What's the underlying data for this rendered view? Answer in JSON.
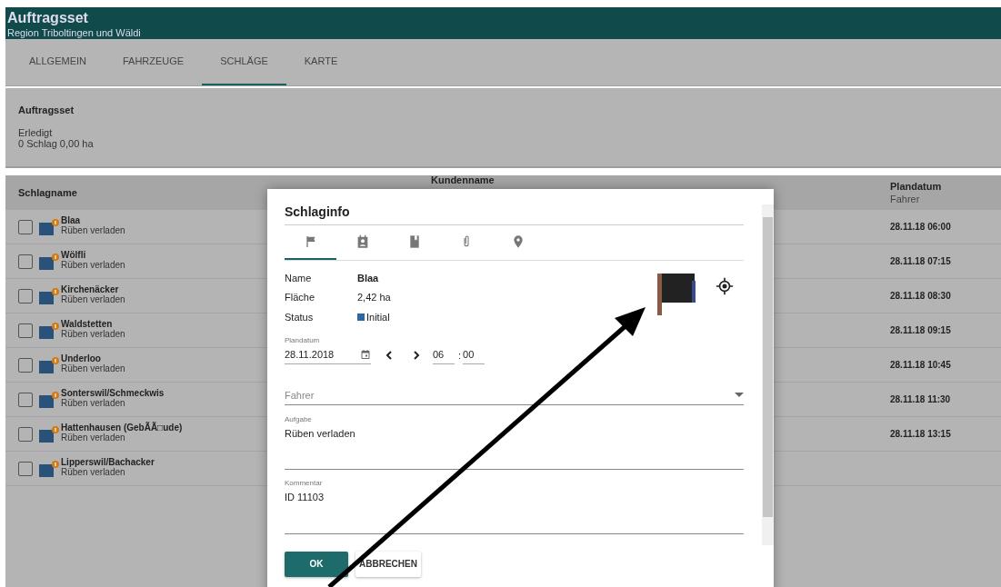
{
  "header": {
    "title": "Auftragsset",
    "subtitle": "Region Triboltingen und Wäldi"
  },
  "tabs": [
    {
      "label": "ALLGEMEIN",
      "selected": false
    },
    {
      "label": "FAHRZEUGE",
      "selected": false
    },
    {
      "label": "SCHLÄGE",
      "selected": true
    },
    {
      "label": "KARTE",
      "selected": false
    }
  ],
  "summary": {
    "title": "Auftragsset",
    "status": "Erledigt",
    "totals": "0 Schlag 0,00 ha"
  },
  "table": {
    "columns": [
      {
        "label": "Schlagname"
      },
      {
        "label": "Kundenname"
      },
      {
        "label": "Plandatum",
        "sublabel": "Fahrer"
      }
    ],
    "rows": [
      {
        "checked": false,
        "name": "Blaa",
        "task": "Rüben verladen",
        "plandatum": "28.11.18 06:00"
      },
      {
        "checked": false,
        "name": "Wölfli",
        "task": "Rüben verladen",
        "plandatum": "28.11.18 07:15"
      },
      {
        "checked": false,
        "name": "Kirchenäcker",
        "task": "Rüben verladen",
        "plandatum": "28.11.18 08:30"
      },
      {
        "checked": false,
        "name": "Waldstetten",
        "task": "Rüben verladen",
        "plandatum": "28.11.18 09:15"
      },
      {
        "checked": false,
        "name": "Underloo",
        "task": "Rüben verladen",
        "plandatum": "28.11.18 10:45"
      },
      {
        "checked": false,
        "name": "Sonterswil/Schmeckwis",
        "task": "Rüben verladen",
        "plandatum": "28.11.18 11:30"
      },
      {
        "checked": false,
        "name": "Hattenhausen (GebÃÃ□ude)",
        "task": "Rüben verladen",
        "plandatum": "28.11.18 13:15"
      },
      {
        "checked": false,
        "name": "Lipperswil/Bachacker",
        "task": "Rüben verladen"
      }
    ]
  },
  "dialog": {
    "title": "Schlaginfo",
    "tabs": [
      {
        "kind": "flag",
        "selected": true
      },
      {
        "kind": "contact",
        "selected": false
      },
      {
        "kind": "book",
        "selected": false
      },
      {
        "kind": "attachment",
        "selected": false
      },
      {
        "kind": "location",
        "selected": false
      }
    ],
    "info": [
      {
        "label": "Name",
        "value": "Blaa",
        "kind": "bold"
      },
      {
        "label": "Fläche",
        "value": "2,42 ha",
        "kind": "plain"
      },
      {
        "label": "Status",
        "value": "Initial",
        "kind": "status"
      }
    ],
    "plandatum": {
      "label": "Plandatum",
      "value": "28.11.2018",
      "hour": "06",
      "separator": ":",
      "minute": "00"
    },
    "driver": {
      "placeholder": "Fahrer"
    },
    "task": {
      "label": "Aufgabe",
      "value": "Rüben verladen"
    },
    "comment": {
      "label": "Kommentar",
      "value": "ID 11103"
    },
    "buttons": [
      {
        "label": "OK",
        "kind": "primary"
      },
      {
        "label": "ABBRECHEN",
        "kind": "secondary"
      }
    ]
  }
}
